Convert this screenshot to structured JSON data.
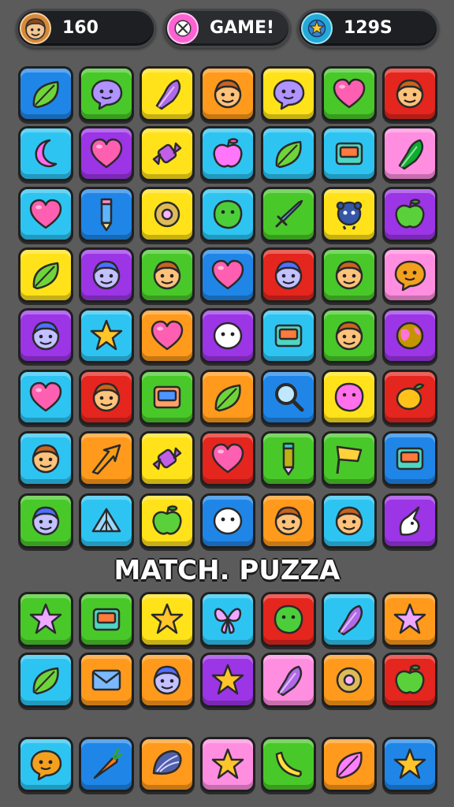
{
  "hud": {
    "score_value": "160",
    "game_label": "GAME!",
    "coins_value": "129S",
    "avatar_icon": "boy-face-icon",
    "game_icon": "crossed-tools-icon",
    "coins_icon": "star-globe-icon"
  },
  "banner": {
    "title": "MATCH. PUZZA"
  },
  "colors": {
    "blue": "#1f86e8",
    "green": "#49c82a",
    "yellow": "#ffe21a",
    "orange": "#ff9a1c",
    "red": "#e4261e",
    "cyan": "#2ec4f2",
    "purple": "#9b35e6",
    "pink": "#ff8ee0"
  },
  "upper_grid": [
    [
      {
        "color": "blue",
        "icon": "leaf"
      },
      {
        "color": "green",
        "icon": "chat-bubble"
      },
      {
        "color": "yellow",
        "icon": "feather"
      },
      {
        "color": "orange",
        "icon": "smiley-face"
      },
      {
        "color": "yellow",
        "icon": "chat-bubble"
      },
      {
        "color": "green",
        "icon": "heart"
      },
      {
        "color": "red",
        "icon": "smiley-face"
      }
    ],
    [
      {
        "color": "cyan",
        "icon": "crescent"
      },
      {
        "color": "purple",
        "icon": "heart"
      },
      {
        "color": "yellow",
        "icon": "candy"
      },
      {
        "color": "cyan",
        "icon": "apple"
      },
      {
        "color": "cyan",
        "icon": "leaf"
      },
      {
        "color": "cyan",
        "icon": "box"
      },
      {
        "color": "pink",
        "icon": "feather"
      }
    ],
    [
      {
        "color": "cyan",
        "icon": "heart"
      },
      {
        "color": "blue",
        "icon": "pencil"
      },
      {
        "color": "yellow",
        "icon": "ring"
      },
      {
        "color": "cyan",
        "icon": "blob"
      },
      {
        "color": "green",
        "icon": "sword"
      },
      {
        "color": "yellow",
        "icon": "monster"
      },
      {
        "color": "purple",
        "icon": "apple"
      }
    ],
    [
      {
        "color": "yellow",
        "icon": "leaf"
      },
      {
        "color": "purple",
        "icon": "smiley-face"
      },
      {
        "color": "green",
        "icon": "smiley-face"
      },
      {
        "color": "blue",
        "icon": "heart"
      },
      {
        "color": "red",
        "icon": "smiley-face"
      },
      {
        "color": "green",
        "icon": "smiley-face"
      },
      {
        "color": "pink",
        "icon": "chat-bubble"
      }
    ],
    [
      {
        "color": "purple",
        "icon": "smiley-face"
      },
      {
        "color": "cyan",
        "icon": "star"
      },
      {
        "color": "orange",
        "icon": "heart"
      },
      {
        "color": "purple",
        "icon": "ghost"
      },
      {
        "color": "cyan",
        "icon": "box"
      },
      {
        "color": "green",
        "icon": "smiley-face"
      },
      {
        "color": "purple",
        "icon": "globe"
      }
    ],
    [
      {
        "color": "cyan",
        "icon": "heart"
      },
      {
        "color": "red",
        "icon": "smiley-face"
      },
      {
        "color": "green",
        "icon": "box"
      },
      {
        "color": "orange",
        "icon": "leaf"
      },
      {
        "color": "blue",
        "icon": "magnifier"
      },
      {
        "color": "yellow",
        "icon": "blob"
      },
      {
        "color": "red",
        "icon": "lemon"
      }
    ],
    [
      {
        "color": "cyan",
        "icon": "smiley-face"
      },
      {
        "color": "orange",
        "icon": "arrow"
      },
      {
        "color": "yellow",
        "icon": "candy"
      },
      {
        "color": "red",
        "icon": "heart"
      },
      {
        "color": "green",
        "icon": "pencil"
      },
      {
        "color": "green",
        "icon": "flag"
      },
      {
        "color": "blue",
        "icon": "box"
      }
    ],
    [
      {
        "color": "green",
        "icon": "smiley-face"
      },
      {
        "color": "cyan",
        "icon": "tent"
      },
      {
        "color": "yellow",
        "icon": "apple"
      },
      {
        "color": "blue",
        "icon": "ghost"
      },
      {
        "color": "orange",
        "icon": "smiley-face"
      },
      {
        "color": "cyan",
        "icon": "smiley-face"
      },
      {
        "color": "purple",
        "icon": "unicorn"
      }
    ]
  ],
  "lower_grid": [
    [
      {
        "color": "green",
        "icon": "star"
      },
      {
        "color": "green",
        "icon": "box"
      },
      {
        "color": "yellow",
        "icon": "star"
      },
      {
        "color": "cyan",
        "icon": "butterfly"
      },
      {
        "color": "red",
        "icon": "blob"
      },
      {
        "color": "cyan",
        "icon": "feather"
      },
      {
        "color": "orange",
        "icon": "star"
      }
    ],
    [
      {
        "color": "cyan",
        "icon": "leaf"
      },
      {
        "color": "orange",
        "icon": "envelope"
      },
      {
        "color": "orange",
        "icon": "smiley-face"
      },
      {
        "color": "purple",
        "icon": "star"
      },
      {
        "color": "pink",
        "icon": "feather"
      },
      {
        "color": "orange",
        "icon": "ring"
      },
      {
        "color": "red",
        "icon": "apple"
      }
    ]
  ],
  "bottom_row": [
    {
      "color": "cyan",
      "icon": "chat-bubble"
    },
    {
      "color": "blue",
      "icon": "carrot"
    },
    {
      "color": "orange",
      "icon": "shell"
    },
    {
      "color": "pink",
      "icon": "star"
    },
    {
      "color": "green",
      "icon": "banana"
    },
    {
      "color": "orange",
      "icon": "leaf"
    },
    {
      "color": "blue",
      "icon": "star"
    }
  ]
}
